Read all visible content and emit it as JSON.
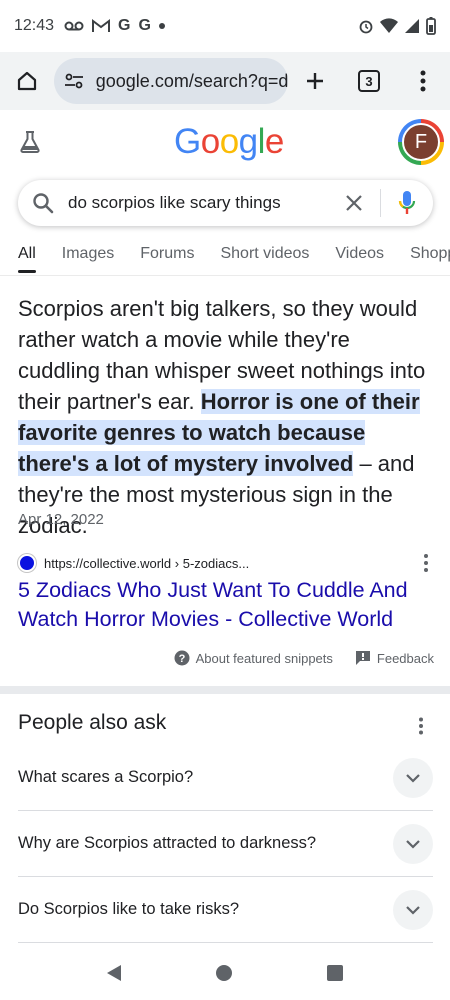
{
  "status_bar": {
    "time": "12:43",
    "left_icons": [
      "voicemail-icon",
      "gmail-icon",
      "google-icon",
      "google-icon",
      "dot-icon"
    ],
    "right_icons": [
      "alarm-icon",
      "wifi-icon",
      "signal-icon",
      "battery-icon"
    ]
  },
  "browser": {
    "url": "google.com/search?q=d",
    "tab_count": "3"
  },
  "google": {
    "logo_letters": [
      {
        "ch": "G",
        "color": "#4285f4"
      },
      {
        "ch": "o",
        "color": "#ea4335"
      },
      {
        "ch": "o",
        "color": "#fbbc05"
      },
      {
        "ch": "g",
        "color": "#4285f4"
      },
      {
        "ch": "l",
        "color": "#34a853"
      },
      {
        "ch": "e",
        "color": "#ea4335"
      }
    ],
    "avatar_letter": "F"
  },
  "search": {
    "query": "do scorpios like scary things"
  },
  "tabs": [
    {
      "label": "All",
      "active": true
    },
    {
      "label": "Images",
      "active": false
    },
    {
      "label": "Forums",
      "active": false
    },
    {
      "label": "Short videos",
      "active": false
    },
    {
      "label": "Videos",
      "active": false
    },
    {
      "label": "Shopping",
      "active": false
    }
  ],
  "snippet": {
    "text_before": "Scorpios aren't big talkers, so they would rather watch a movie while they're cuddling than whisper sweet nothings into their partner's ear. ",
    "text_highlight": "Horror is one of their favorite genres to watch because there's a lot of mystery involved",
    "text_after": " – and they're the most mysterious sign in the zodiac.",
    "date": "Apr 12, 2022",
    "source_url": "https://collective.world › 5-zodiacs...",
    "result_title": "5 Zodiacs Who Just Want To Cuddle And Watch Horror Movies - Collective World",
    "about_label": "About featured snippets",
    "feedback_label": "Feedback"
  },
  "paa": {
    "title": "People also ask",
    "questions": [
      "What scares a Scorpio?",
      "Why are Scorpios attracted to darkness?",
      "Do Scorpios like to take risks?"
    ]
  }
}
